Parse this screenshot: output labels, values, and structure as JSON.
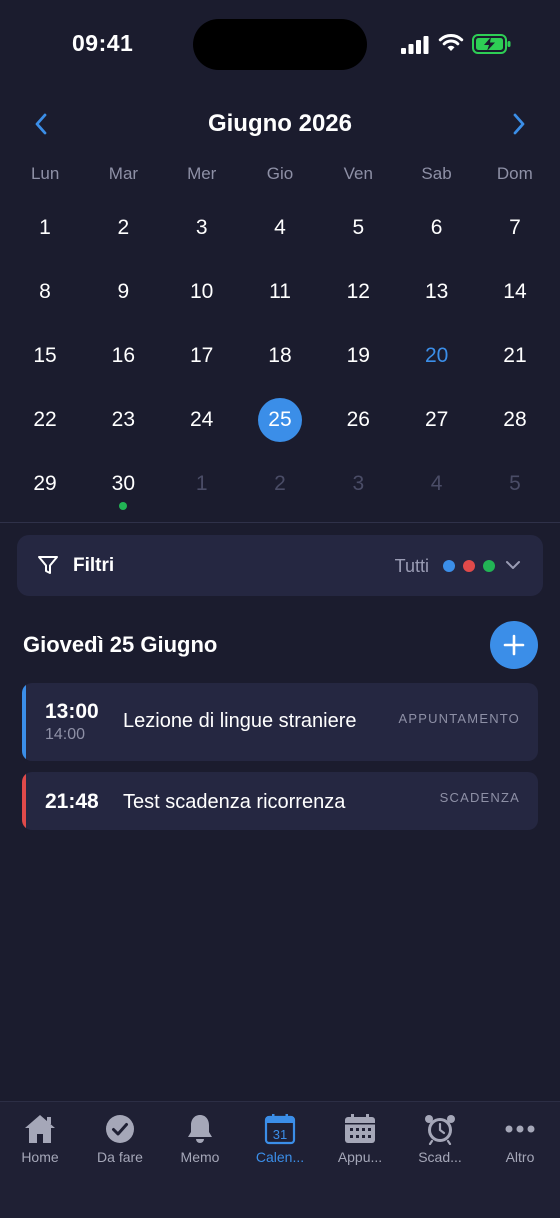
{
  "status": {
    "time": "09:41"
  },
  "calendar": {
    "month_title": "Giugno 2026",
    "weekdays": [
      "Lun",
      "Mar",
      "Mer",
      "Gio",
      "Ven",
      "Sab",
      "Dom"
    ],
    "weeks": [
      [
        {
          "d": "1"
        },
        {
          "d": "2"
        },
        {
          "d": "3"
        },
        {
          "d": "4"
        },
        {
          "d": "5"
        },
        {
          "d": "6"
        },
        {
          "d": "7"
        }
      ],
      [
        {
          "d": "8"
        },
        {
          "d": "9"
        },
        {
          "d": "10"
        },
        {
          "d": "11"
        },
        {
          "d": "12"
        },
        {
          "d": "13"
        },
        {
          "d": "14"
        }
      ],
      [
        {
          "d": "15"
        },
        {
          "d": "16"
        },
        {
          "d": "17"
        },
        {
          "d": "18"
        },
        {
          "d": "19"
        },
        {
          "d": "20",
          "today": true
        },
        {
          "d": "21"
        }
      ],
      [
        {
          "d": "22"
        },
        {
          "d": "23"
        },
        {
          "d": "24"
        },
        {
          "d": "25",
          "selected": true
        },
        {
          "d": "26"
        },
        {
          "d": "27"
        },
        {
          "d": "28"
        }
      ],
      [
        {
          "d": "29"
        },
        {
          "d": "30",
          "dot": "#22b455"
        },
        {
          "d": "1",
          "other": true
        },
        {
          "d": "2",
          "other": true
        },
        {
          "d": "3",
          "other": true
        },
        {
          "d": "4",
          "other": true
        },
        {
          "d": "5",
          "other": true
        }
      ]
    ]
  },
  "filter": {
    "label": "Filtri",
    "value": "Tutti",
    "dot_colors": [
      "#3b8ee8",
      "#e04a4a",
      "#22b455"
    ]
  },
  "day_heading": "Giovedì 25 Giugno",
  "events": [
    {
      "start": "13:00",
      "end": "14:00",
      "title": "Lezione di lingue straniere",
      "type": "APPUNTAMENTO",
      "color": "#3b8ee8"
    },
    {
      "start": "21:48",
      "end": "",
      "title": "Test scadenza ricorrenza",
      "type": "SCADENZA",
      "color": "#e04a4a"
    }
  ],
  "tabs": [
    {
      "label": "Home",
      "icon": "home-icon"
    },
    {
      "label": "Da fare",
      "icon": "checkmark-circle-icon"
    },
    {
      "label": "Memo",
      "icon": "bell-icon"
    },
    {
      "label": "Calen...",
      "icon": "calendar-icon",
      "active": true,
      "icon_text": "31"
    },
    {
      "label": "Appu...",
      "icon": "calendar-grid-icon"
    },
    {
      "label": "Scad...",
      "icon": "alarm-clock-icon"
    },
    {
      "label": "Altro",
      "icon": "more-icon"
    }
  ],
  "colors": {
    "accent": "#3b8ee8",
    "background": "#1b1c2e",
    "card": "#252741"
  }
}
